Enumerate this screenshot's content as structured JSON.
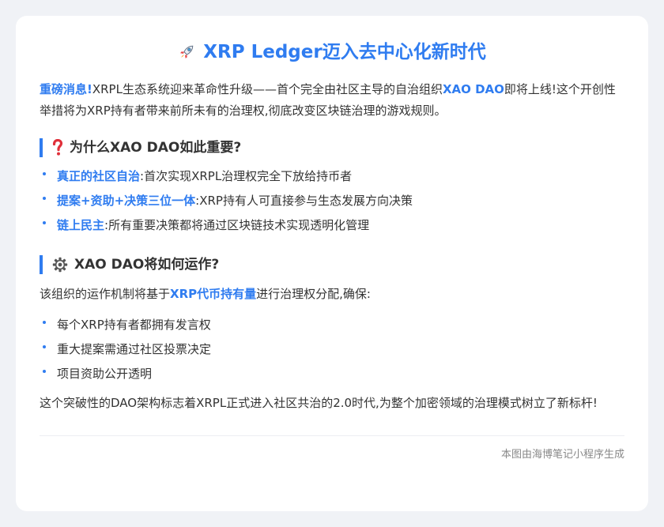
{
  "title": "XRP Ledger迈入去中心化新时代",
  "intro": {
    "lead": "重磅消息!",
    "text1": "XRPL生态系统迎来革命性升级——首个完全由社区主导的自治组织",
    "org": "XAO DAO",
    "text2": "即将上线!这个开创性举措将为XRP持有者带来前所未有的治理权,彻底改变区块链治理的游戏规则。"
  },
  "section1": {
    "heading": "为什么XAO DAO如此重要?",
    "items": [
      {
        "label": "真正的社区自治",
        "text": ":首次实现XRPL治理权完全下放给持币者"
      },
      {
        "label": "提案+资助+决策三位一体",
        "text": ":XRP持有人可直接参与生态发展方向决策"
      },
      {
        "label": "链上民主",
        "text": ":所有重要决策都将通过区块链技术实现透明化管理"
      }
    ]
  },
  "section2": {
    "heading": "XAO DAO将如何运作?",
    "text1": "该组织的运作机制将基于",
    "highlight": "XRP代币持有量",
    "text2": "进行治理权分配,确保:",
    "items": [
      "每个XRP持有者都拥有发言权",
      "重大提案需通过社区投票决定",
      "项目资助公开透明"
    ]
  },
  "closing": "这个突破性的DAO架构标志着XRPL正式进入社区共治的2.0时代,为整个加密领域的治理模式树立了新标杆!",
  "footer": "本图由海博笔记小程序生成",
  "icons": {
    "title": "rocket-icon",
    "section1": "question-mark-icon",
    "section2": "gear-icon"
  },
  "colors": {
    "accent": "#2f7cf0",
    "question": "#e0303a"
  }
}
